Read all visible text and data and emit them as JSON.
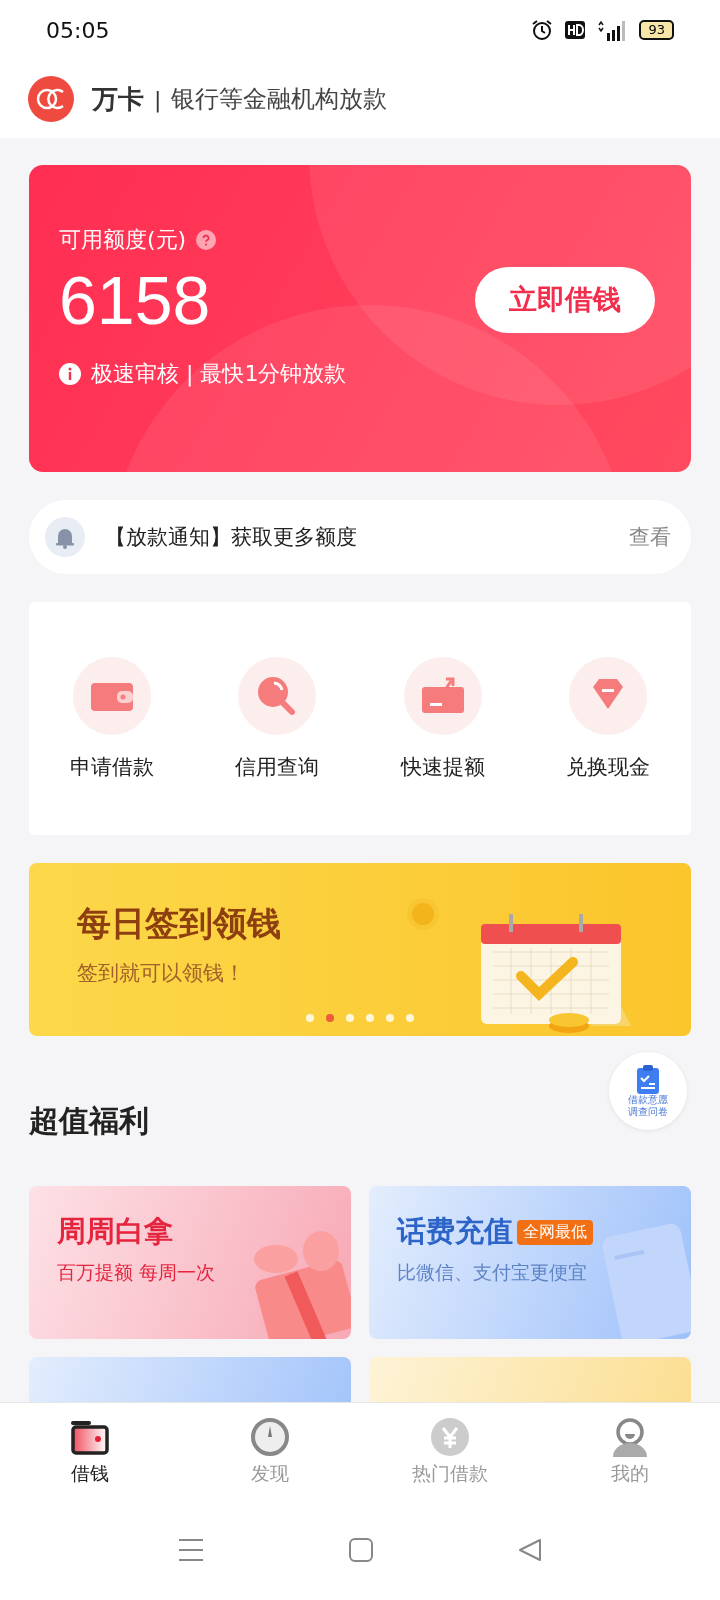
{
  "status_bar": {
    "time": "05:05",
    "battery": "93"
  },
  "header": {
    "brand": "万卡",
    "separator": "|",
    "subtitle": "银行等金融机构放款"
  },
  "credit_card": {
    "label": "可用额度(元)",
    "amount": "6158",
    "button": "立即借钱",
    "note": "极速审核 | 最快1分钟放款"
  },
  "notice": {
    "text": "【放款通知】获取更多额度",
    "action": "查看"
  },
  "shortcuts": [
    {
      "kind": "wallet",
      "label": "申请借款"
    },
    {
      "kind": "search",
      "label": "信用查询"
    },
    {
      "kind": "raise",
      "label": "快速提额"
    },
    {
      "kind": "diamond",
      "label": "兑换现金"
    }
  ],
  "banner": {
    "title": "每日签到领钱",
    "subtitle": "签到就可以领钱！",
    "dots": [
      {
        "selected": false
      },
      {
        "selected": true
      },
      {
        "selected": false
      },
      {
        "selected": false
      },
      {
        "selected": false
      },
      {
        "selected": false
      }
    ]
  },
  "survey_button": {
    "lines": [
      "借款意愿",
      "调查问卷"
    ]
  },
  "section_title": "超值福利",
  "benefits": [
    {
      "kind": "pink",
      "title": "周周白拿",
      "subtitle": "百万提额 每周一次"
    },
    {
      "kind": "blue",
      "title": "话费充值",
      "tag": "全网最低",
      "subtitle": "比微信、支付宝更便宜"
    },
    {
      "kind": "blue"
    },
    {
      "kind": "yellow"
    }
  ],
  "tabs": [
    {
      "kind": "wallet",
      "label": "借钱",
      "selected": true
    },
    {
      "kind": "compass",
      "label": "发现",
      "selected": false
    },
    {
      "kind": "yen",
      "label": "热门借款",
      "selected": false
    },
    {
      "kind": "person",
      "label": "我的",
      "selected": false
    }
  ]
}
